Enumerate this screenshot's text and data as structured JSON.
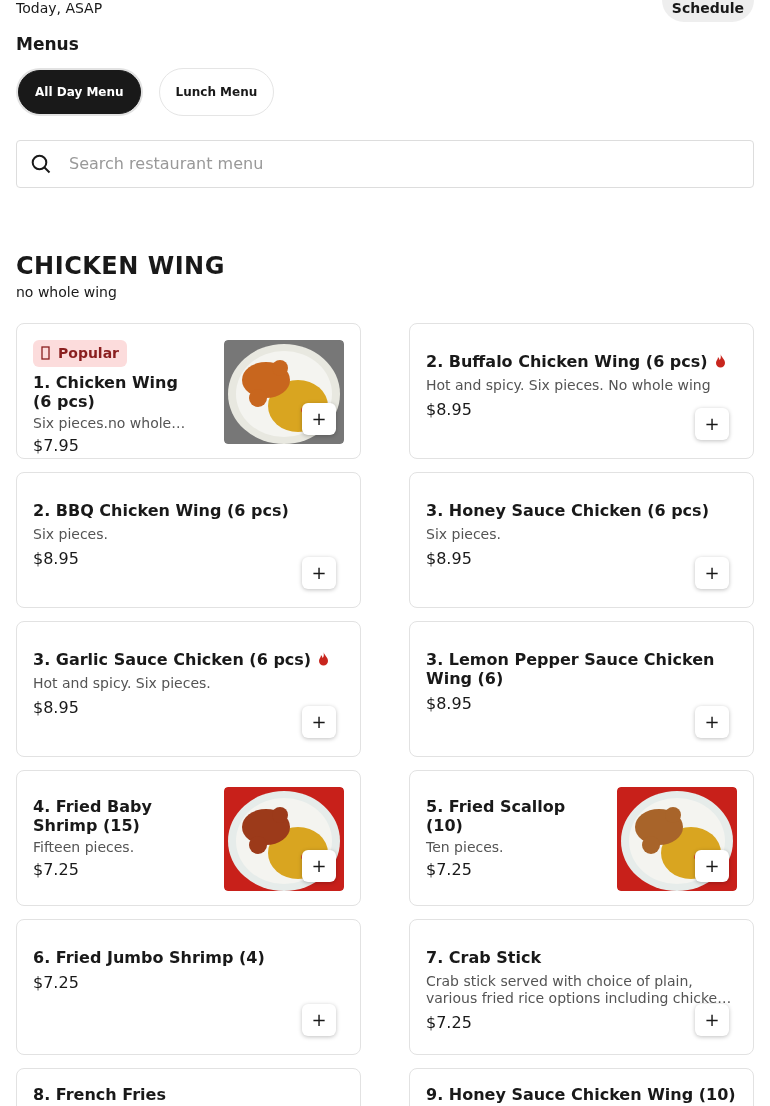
{
  "header": {
    "time": "Today, ASAP",
    "schedule_button": "Schedule"
  },
  "menus": {
    "title": "Menus",
    "tabs": [
      {
        "label": "All Day Menu",
        "selected": true
      },
      {
        "label": "Lunch Menu",
        "selected": false
      }
    ]
  },
  "search": {
    "placeholder": "Search restaurant menu"
  },
  "section": {
    "title": "CHICKEN WING",
    "subtitle": "no whole wing"
  },
  "items": [
    {
      "name": "1. Chicken Wing (6 pcs)",
      "description": "Six pieces.no whole…",
      "price": "$7.95",
      "badge": "Popular",
      "spicy": false,
      "kind": "picture",
      "add": "+"
    },
    {
      "name": "2. Buffalo Chicken Wing (6 pcs)",
      "description": "Hot and spicy. Six pieces. No whole wing",
      "price": "$8.95",
      "spicy": true,
      "add": "+"
    },
    {
      "name": "2. BBQ Chicken Wing (6 pcs)",
      "description": "Six pieces.",
      "price": "$8.95",
      "spicy": false,
      "add": "+"
    },
    {
      "name": "3. Honey Sauce Chicken (6 pcs)",
      "description": "Six pieces.",
      "price": "$8.95",
      "spicy": false,
      "add": "+"
    },
    {
      "name": "3. Garlic Sauce Chicken (6 pcs)",
      "description": "Hot and spicy. Six pieces.",
      "price": "$8.95",
      "spicy": true,
      "add": "+"
    },
    {
      "name": "3. Lemon Pepper Sauce Chicken Wing (6)",
      "price": "$8.95",
      "spicy": false,
      "add": "+"
    },
    {
      "name": "4. Fried Baby Shrimp (15)",
      "description": "Fifteen pieces.",
      "price": "$7.25",
      "spicy": false,
      "kind": "picture",
      "add": "+"
    },
    {
      "name": "5. Fried Scallop (10)",
      "description": "Ten pieces.",
      "price": "$7.25",
      "spicy": false,
      "kind": "picture",
      "add": "+"
    },
    {
      "name": "6. Fried Jumbo Shrimp (4)",
      "price": "$7.25",
      "spicy": false,
      "add": "+"
    },
    {
      "name": "7. Crab Stick",
      "description": "Crab stick served with choice of plain, various fried rice options including chicke…",
      "price": "$7.25",
      "spicy": false,
      "add": "+"
    },
    {
      "name": "8. French Fries",
      "spicy": false
    },
    {
      "name": "9. Honey Sauce Chicken Wing (10)",
      "spicy": false
    }
  ]
}
